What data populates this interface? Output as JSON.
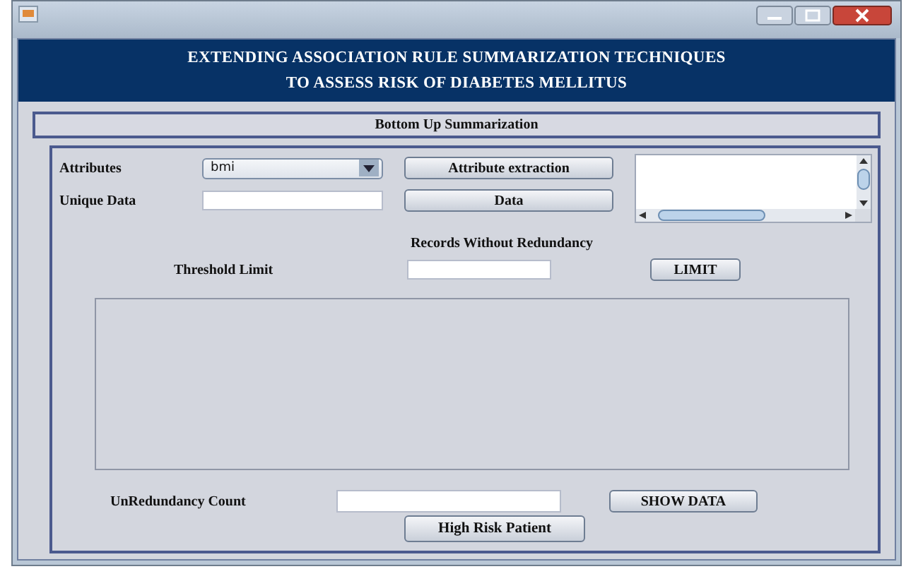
{
  "header": {
    "title_lines": [
      "EXTENDING ASSOCIATION RULE SUMMARIZATION TECHNIQUES",
      "TO ASSESS RISK OF DIABETES MELLITUS"
    ]
  },
  "section_title": "Bottom Up Summarization",
  "attributes": {
    "label": "Attributes",
    "value": "bmi",
    "button": "Attribute extraction"
  },
  "unique_data": {
    "label": "Unique Data",
    "button": "Data"
  },
  "records_heading": "Records Without Redundancy",
  "threshold": {
    "label": "Threshold Limit",
    "button": "LIMIT"
  },
  "count": {
    "label": "UnRedundancy Count",
    "button": "SHOW DATA"
  },
  "high_risk_button": "High Risk Patient"
}
